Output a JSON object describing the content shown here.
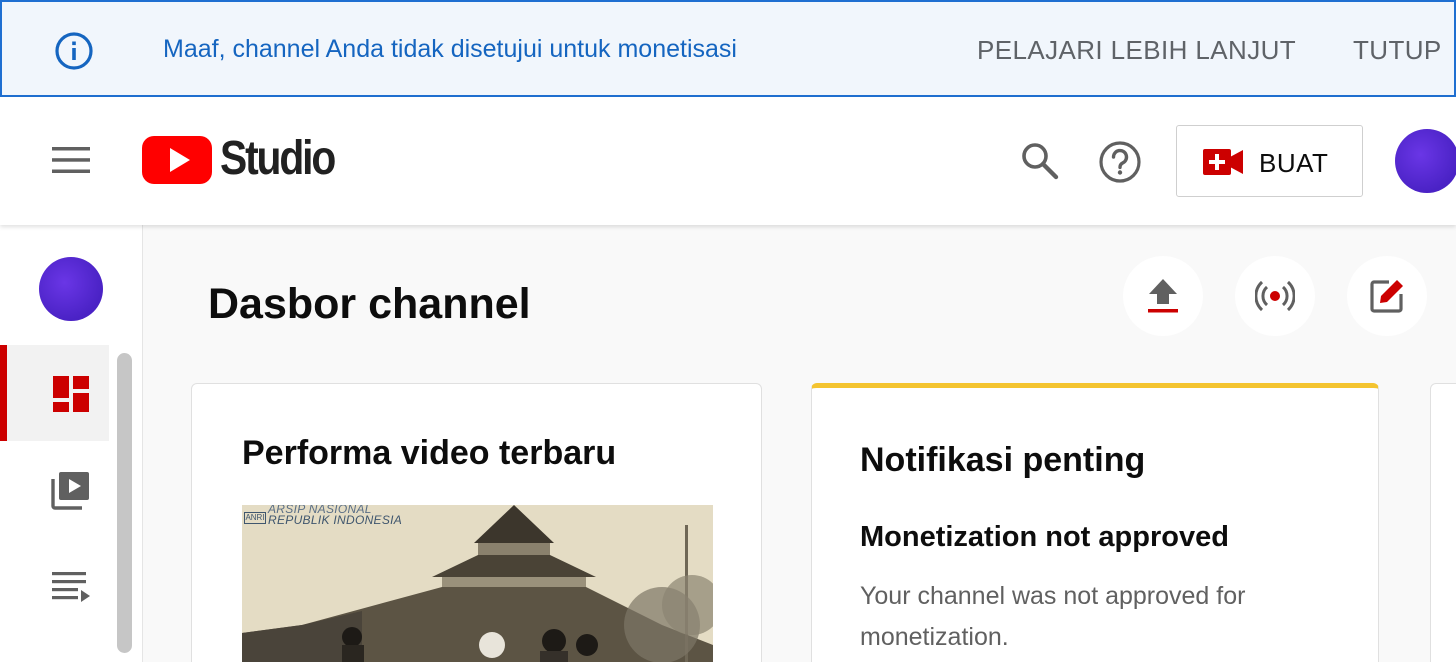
{
  "banner": {
    "message": "Maaf, channel Anda tidak disetujui untuk monetisasi",
    "learn_more": "PELAJARI LEBIH LANJUT",
    "close": "TUTUP",
    "accent_color": "#1565c0"
  },
  "header": {
    "app_name": "Studio",
    "create_label": "BUAT",
    "icons": [
      "menu-icon",
      "youtube-logo",
      "search-icon",
      "help-icon",
      "create-video-icon",
      "avatar"
    ]
  },
  "sidebar": {
    "items": [
      {
        "name": "dashboard",
        "icon": "dashboard-icon",
        "active": true
      },
      {
        "name": "content",
        "icon": "video-library-icon",
        "active": false
      },
      {
        "name": "playlists",
        "icon": "playlist-icon",
        "active": false
      }
    ],
    "active_color": "#cc0000"
  },
  "main": {
    "title": "Dasbor channel",
    "actions": [
      "upload-icon",
      "live-icon",
      "create-post-icon"
    ],
    "cards": {
      "performance": {
        "title": "Performa video terbaru",
        "thumbnail_watermark_line1": "ARSIP NASIONAL",
        "thumbnail_watermark_line2": "REPUBLIK INDONESIA",
        "thumbnail_logo": "ANRI"
      },
      "notifications": {
        "title": "Notifikasi penting",
        "heading": "Monetization not approved",
        "body": "Your channel was not approved for monetization.",
        "accent_color": "#f4c430"
      }
    }
  }
}
